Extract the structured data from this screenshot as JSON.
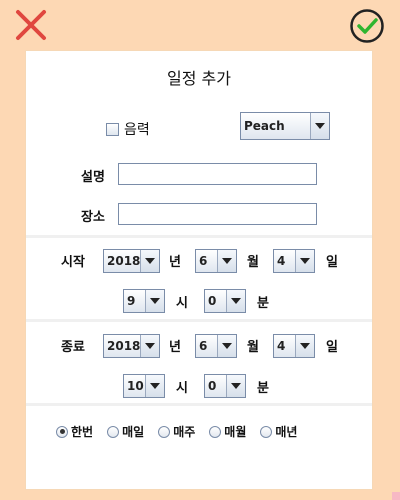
{
  "dialog": {
    "title": "일정 추가",
    "close_icon": "close-icon",
    "confirm_icon": "check-circle-icon",
    "accent_colors": {
      "background": "#fdd8b4",
      "close": "#e0473f",
      "confirm": "#2fb52f"
    }
  },
  "lunar": {
    "label": "음력",
    "checked": false
  },
  "color_select": {
    "value": "Peach"
  },
  "description": {
    "label": "설명",
    "value": ""
  },
  "location": {
    "label": "장소",
    "value": ""
  },
  "start": {
    "label": "시작",
    "year": "2018",
    "year_unit": "년",
    "month": "6",
    "month_unit": "월",
    "day": "4",
    "day_unit": "일",
    "hour": "9",
    "hour_unit": "시",
    "minute": "0",
    "minute_unit": "분"
  },
  "end": {
    "label": "종료",
    "year": "2018",
    "year_unit": "년",
    "month": "6",
    "month_unit": "월",
    "day": "4",
    "day_unit": "일",
    "hour": "10",
    "hour_unit": "시",
    "minute": "0",
    "minute_unit": "분"
  },
  "repeat": {
    "selected": "한번",
    "options": [
      "한번",
      "매일",
      "매주",
      "매월",
      "매년"
    ]
  }
}
